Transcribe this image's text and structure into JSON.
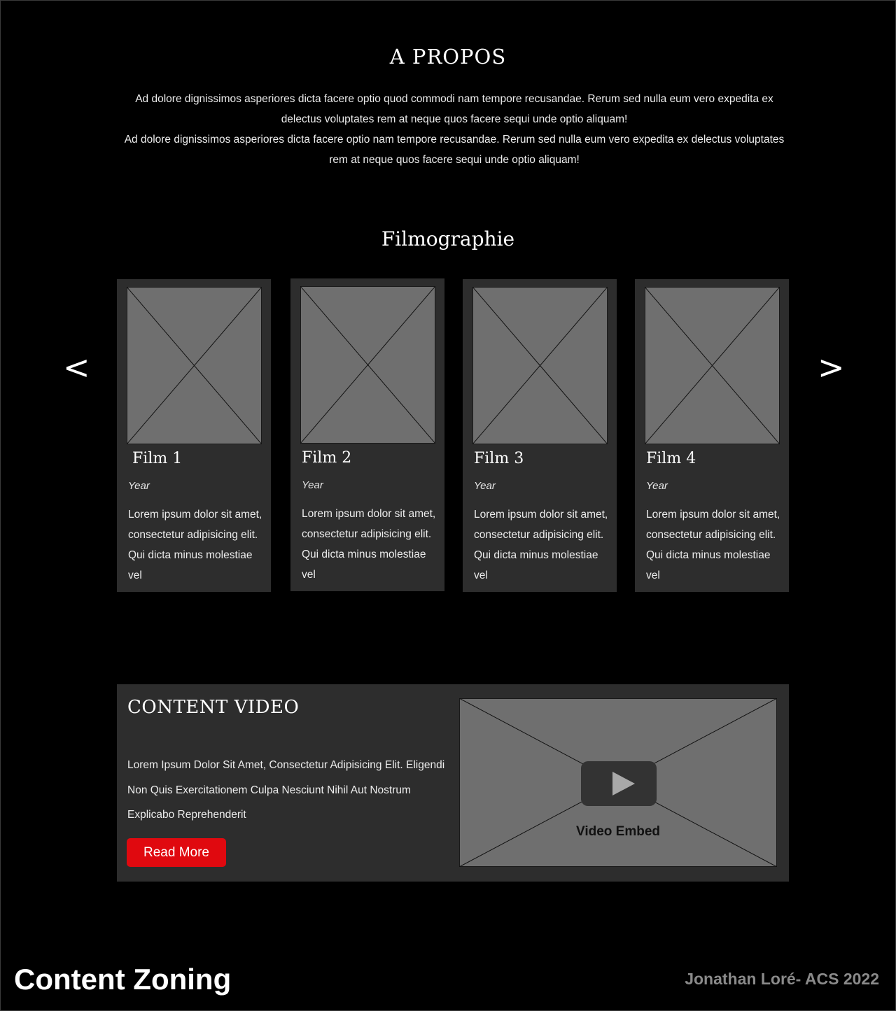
{
  "about": {
    "title": "A PROPOS",
    "paragraphs": [
      "Ad dolore dignissimos asperiores dicta facere optio quod commodi nam tempore recusandae. Rerum sed nulla eum vero expedita ex delectus voluptates rem at neque quos facere sequi unde optio aliquam!",
      "Ad dolore dignissimos asperiores dicta facere optio nam tempore recusandae. Rerum sed nulla eum vero expedita ex delectus voluptates rem at neque quos facere sequi unde optio aliquam!"
    ]
  },
  "filmography": {
    "title": "Filmographie",
    "prev_label": "<",
    "next_label": ">",
    "films": [
      {
        "title": "Film 1",
        "year": "Year",
        "description": "Lorem ipsum dolor sit amet, consectetur adipisicing elit. Qui dicta minus molestiae vel"
      },
      {
        "title": "Film 2",
        "year": "Year",
        "description": "Lorem ipsum dolor sit amet, consectetur adipisicing elit. Qui dicta minus molestiae vel"
      },
      {
        "title": "Film 3",
        "year": "Year",
        "description": "Lorem ipsum dolor sit amet, consectetur adipisicing elit. Qui dicta minus molestiae vel"
      },
      {
        "title": "Film 4",
        "year": "Year",
        "description": "Lorem ipsum dolor sit amet, consectetur adipisicing elit. Qui dicta minus molestiae vel"
      }
    ]
  },
  "video_section": {
    "title": "CONTENT VIDEO",
    "text": "Lorem Ipsum Dolor Sit Amet, Consectetur Adipisicing Elit. Eligendi Non Quis Exercitationem Culpa Nesciunt Nihil Aut Nostrum Explicabo Reprehenderit",
    "read_more_label": "Read More",
    "embed_label": "Video Embed",
    "embed_icon": "play-icon"
  },
  "footer": {
    "title": "Content Zoning",
    "credit": "Jonathan Loré- ACS 2022"
  },
  "colors": {
    "background": "#000000",
    "card": "#2d2d2d",
    "placeholder": "#6f6f6f",
    "accent": "#e0090f",
    "credit": "#8a8a8a"
  }
}
